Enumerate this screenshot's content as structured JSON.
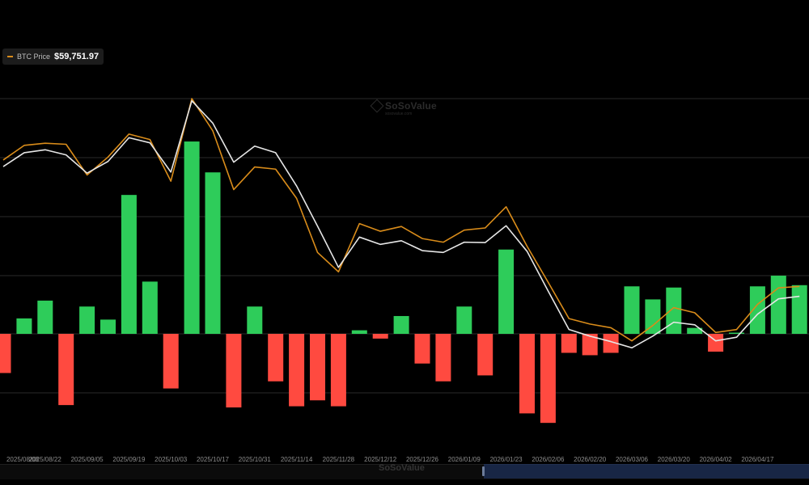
{
  "legend": {
    "label": "BTC Price",
    "value": "$59,751.97",
    "color": "#d98c1a"
  },
  "watermark": {
    "text": "SoSoValue",
    "subtext": "sosovalue.com"
  },
  "navigator_watermark": "SoSoValue",
  "colors": {
    "background": "#000000",
    "grid": "#2a2a2a",
    "positive_bar": "#2ecc5a",
    "negative_bar": "#ff4a40",
    "btc_price_line": "#d98c1a",
    "white_line": "#e6e6e6",
    "axis_text": "#8c8c8c"
  },
  "chart_data": {
    "type": "bar",
    "title": "",
    "xlabel": "",
    "ylabel": "",
    "grid": true,
    "legend_position": "top-left",
    "x_tick_labels": [
      "2025/08/08",
      "2025/08/22",
      "2025/09/05",
      "2025/09/19",
      "2025/10/03",
      "2025/10/17",
      "2025/10/31",
      "2025/11/14",
      "2025/11/28",
      "2025/12/12",
      "2025/12/26",
      "2026/01/09",
      "2026/01/23",
      "2026/02/06",
      "2026/02/20",
      "2026/03/06",
      "2026/03/20",
      "2026/04/02",
      "2026/04/17"
    ],
    "flow_range": [
      -120,
      200
    ],
    "series": [
      {
        "name": "",
        "kind": "bar",
        "values": [
          -33,
          13,
          28,
          -60,
          23,
          12,
          117,
          44,
          -46,
          162,
          136,
          -62,
          23,
          -40,
          -61,
          -56,
          -61,
          3,
          -4,
          15,
          -25,
          -40,
          23,
          -35,
          71,
          -67,
          -75,
          -16,
          -18,
          -16,
          40,
          29,
          39,
          5,
          -15,
          1,
          40,
          49,
          41
        ]
      },
      {
        "name": "BTC Price",
        "kind": "line",
        "values": [
          109400,
          113400,
          114000,
          113700,
          105300,
          110200,
          116500,
          115000,
          103600,
          126200,
          117400,
          101300,
          107500,
          106900,
          98900,
          84100,
          78800,
          92000,
          89900,
          91200,
          87900,
          86900,
          90200,
          90800,
          96600,
          85800,
          76000,
          66000,
          64500,
          63500,
          59900,
          64100,
          69000,
          67600,
          62200,
          63000,
          69900,
          74400,
          74800
        ]
      },
      {
        "name": "",
        "kind": "line",
        "values": [
          107600,
          111400,
          112200,
          110800,
          105800,
          109000,
          115500,
          114100,
          106100,
          125600,
          119500,
          108800,
          113200,
          111400,
          102300,
          91300,
          80000,
          88300,
          86300,
          87300,
          84600,
          84100,
          86900,
          86800,
          91400,
          84400,
          73600,
          63000,
          61200,
          59700,
          58000,
          61200,
          65000,
          64300,
          59900,
          60900,
          67200,
          71400,
          72100
        ]
      }
    ]
  }
}
